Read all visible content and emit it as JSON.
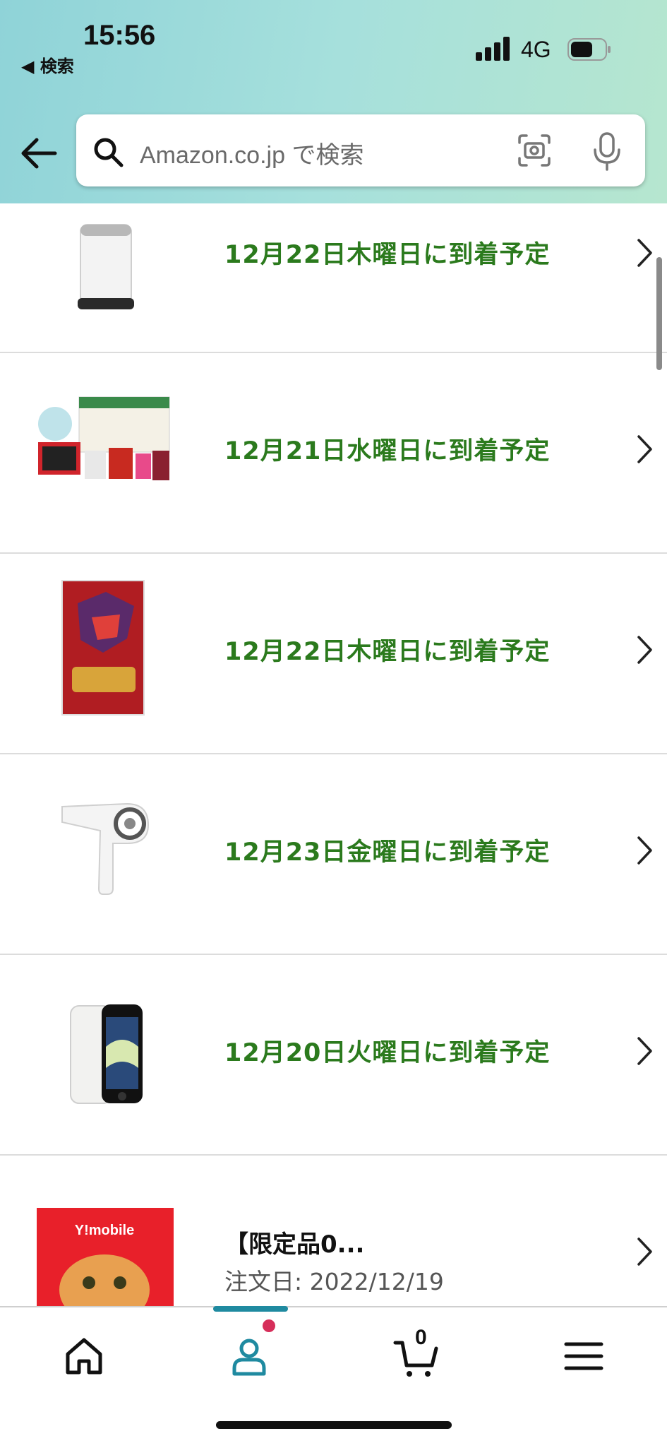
{
  "status_bar": {
    "time": "15:56",
    "back_app": "◀ 検索",
    "network": "4G"
  },
  "search": {
    "placeholder": "Amazon.co.jp で検索"
  },
  "orders": [
    {
      "status": "12月22日木曜日に到着予定",
      "product": "air-purifier"
    },
    {
      "status": "12月21日水曜日に到着予定",
      "product": "nintendo-switch-holiday-set"
    },
    {
      "status": "12月22日木曜日に到着予定",
      "product": "pokemon-scarlet-game"
    },
    {
      "status": "12月23日金曜日に到着予定",
      "product": "hair-dryer"
    },
    {
      "status": "12月20日火曜日に到着予定",
      "product": "iphone-se"
    },
    {
      "title": "【限定品0...",
      "order_date": "注文日: 2022/12/19",
      "product": "ymobile-card",
      "thumb_brand": "Y!mobile"
    }
  ],
  "tabbar": {
    "cart_count": "0",
    "active_tab": "account"
  },
  "colors": {
    "delivery_green": "#2b7a1d",
    "tab_accent": "#1f8aa0",
    "notify_dot": "#d62e5a"
  }
}
